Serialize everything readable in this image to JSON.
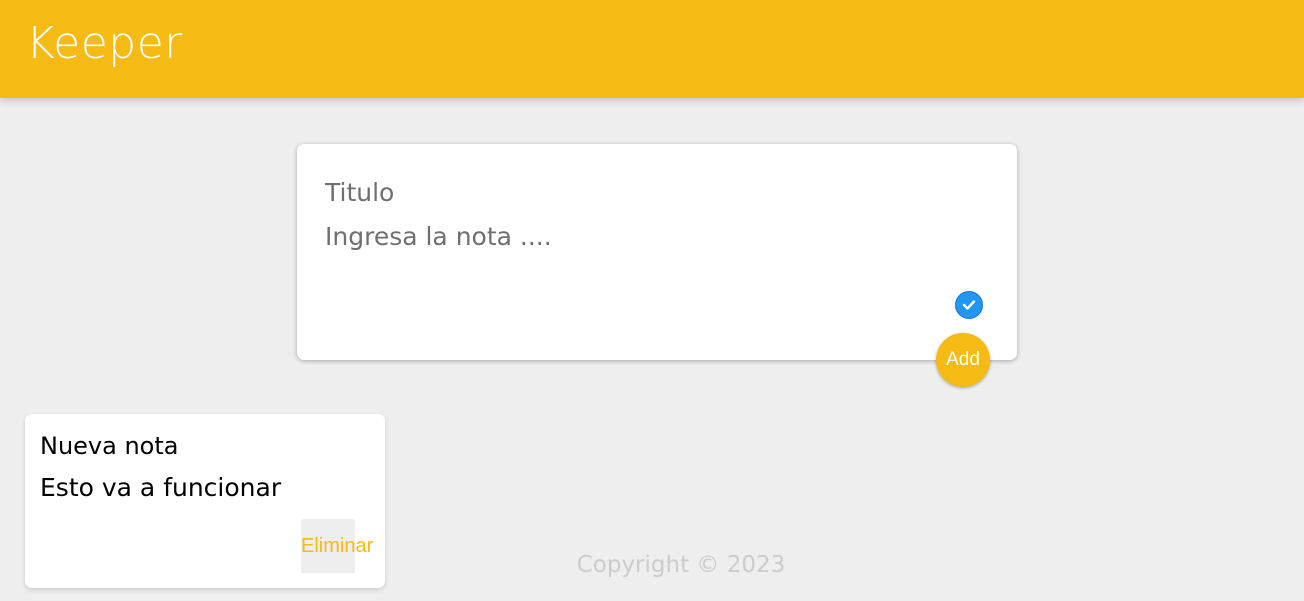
{
  "header": {
    "logo": "Keeper"
  },
  "create_note": {
    "title_placeholder": "Titulo",
    "content_placeholder": "Ingresa la nota ....",
    "add_label": "Add"
  },
  "notes": [
    {
      "title": "Nueva nota",
      "content": "Esto va a funcionar",
      "delete_label": "Eliminar"
    }
  ],
  "footer": {
    "copyright": "Copyright © 2023"
  },
  "colors": {
    "accent": "#f5ba13",
    "background": "#eeeeee",
    "check_icon": "#2196f3"
  },
  "icons": {
    "check": "check-circle-icon"
  }
}
